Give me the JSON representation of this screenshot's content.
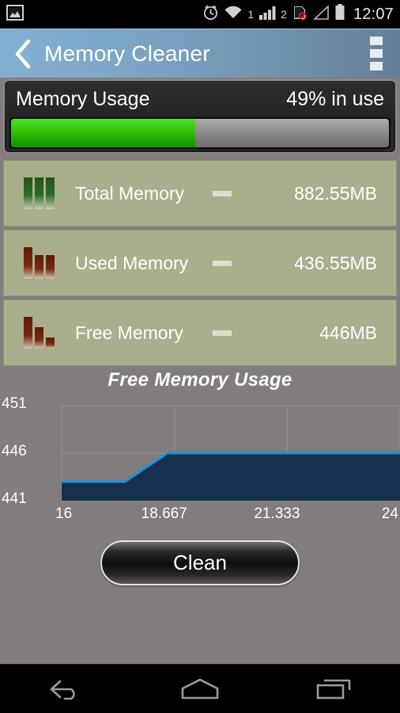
{
  "statusbar": {
    "icons": [
      "gallery-image-icon",
      "alarm-clock-icon",
      "wifi-icon",
      "signal-bars-icon",
      "sim-blocked-icon",
      "signal-empty-icon",
      "battery-icon"
    ],
    "sim1_label": "1",
    "sim2_label": "2",
    "clock": "12:07"
  },
  "actionbar": {
    "back_icon": "back-chevron-icon",
    "title": "Memory Cleaner",
    "overflow_icon": "overflow-menu-icon"
  },
  "usage": {
    "title": "Memory Usage",
    "percent_label": "49% in use",
    "percent_value": 49,
    "fill_color": "#2fc107",
    "track_color": "#8c8c8c"
  },
  "rows": [
    {
      "icon": "green-bar-chart-icon",
      "label": "Total Memory",
      "separator": "—",
      "value": "882.55MB"
    },
    {
      "icon": "red-bar-chart-icon",
      "label": "Used Memory",
      "separator": "—",
      "value": "436.55MB"
    },
    {
      "icon": "red-bar-chart-icon",
      "label": "Free Memory",
      "separator": "—",
      "value": "446MB"
    }
  ],
  "chart_data": {
    "type": "area",
    "title": "Free Memory Usage",
    "xlabel": "",
    "ylabel": "",
    "x": [
      16,
      17.5,
      18.5,
      19.5,
      21.333,
      24
    ],
    "values": [
      443,
      443,
      446,
      446,
      446,
      446
    ],
    "ytick_labels": [
      "441",
      "446",
      "451"
    ],
    "yticks": [
      441,
      446,
      451
    ],
    "xtick_labels": [
      "16",
      "18.667",
      "21.333",
      "24"
    ],
    "xticks": [
      16,
      18.667,
      21.333,
      24
    ],
    "ylim": [
      441,
      451
    ],
    "xlim": [
      16,
      24
    ],
    "grid": true,
    "line_color": "#1e8ede",
    "fill_color": "#16314d",
    "legend": "none"
  },
  "clean": {
    "label": "Clean"
  },
  "navbar": {
    "back": "nav-back-icon",
    "home": "nav-home-icon",
    "recents": "nav-recents-icon"
  },
  "colors": {
    "background": "#807d7c",
    "row_background": "#a9ae8c",
    "accent_blue": "#7ba4c4"
  }
}
